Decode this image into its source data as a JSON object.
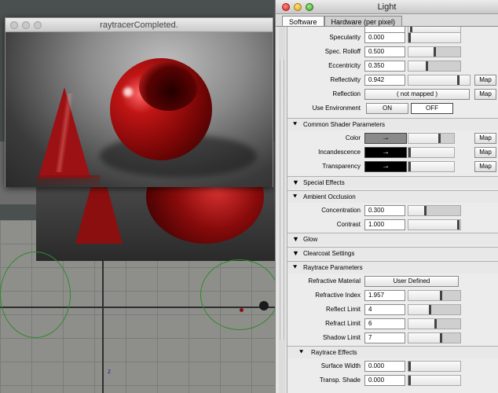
{
  "render_window": {
    "title": "raytracerCompleted."
  },
  "panel": {
    "title": "Light",
    "tabs": [
      {
        "label": "Software",
        "active": true
      },
      {
        "label": "Hardware (per pixel)",
        "active": false
      }
    ],
    "rows": {
      "specularity": {
        "label": "Specularity",
        "value": "0.000"
      },
      "spec_rolloff": {
        "label": "Spec. Rolloff",
        "value": "0.500"
      },
      "eccentricity": {
        "label": "Eccentricity",
        "value": "0.350"
      },
      "reflectivity": {
        "label": "Reflectivity",
        "value": "0.942",
        "map": "Map"
      },
      "reflection": {
        "label": "Reflection",
        "value": "( not mapped )",
        "map": "Map"
      },
      "use_environment": {
        "label": "Use Environment",
        "on": "ON",
        "off": "OFF",
        "selected": "OFF"
      }
    },
    "common": {
      "header": "Common Shader Parameters",
      "color": {
        "label": "Color",
        "icon": "→",
        "map": "Map",
        "swatch": "#8a8a8a"
      },
      "incandescence": {
        "label": "Incandescence",
        "icon": "→",
        "map": "Map",
        "swatch": "#000000"
      },
      "transparency": {
        "label": "Transparency",
        "icon": "→",
        "map": "Map",
        "swatch": "#000000"
      }
    },
    "special_effects": {
      "header": "Special Effects"
    },
    "ambient": {
      "header": "Ambient Occlusion",
      "concentration": {
        "label": "Concentration",
        "value": "0.300"
      },
      "contrast": {
        "label": "Contrast",
        "value": "1.000"
      }
    },
    "glow": {
      "header": "Glow"
    },
    "clearcoat": {
      "header": "Clearcoat Settings"
    },
    "raytrace": {
      "header": "Raytrace Parameters",
      "refractive_material": {
        "label": "Refractive Material",
        "value": "User Defined"
      },
      "refractive_index": {
        "label": "Refractive Index",
        "value": "1.957"
      },
      "reflect_limit": {
        "label": "Reflect Limit",
        "value": "4"
      },
      "refract_limit": {
        "label": "Refract Limit",
        "value": "6"
      },
      "shadow_limit": {
        "label": "Shadow Limit",
        "value": "7"
      }
    },
    "raytrace_effects": {
      "header": "Raytrace Effects",
      "surface_width": {
        "label": "Surface Width",
        "value": "0.000"
      },
      "transp_shade": {
        "label": "Transp. Shade",
        "value": "0.000"
      }
    }
  }
}
